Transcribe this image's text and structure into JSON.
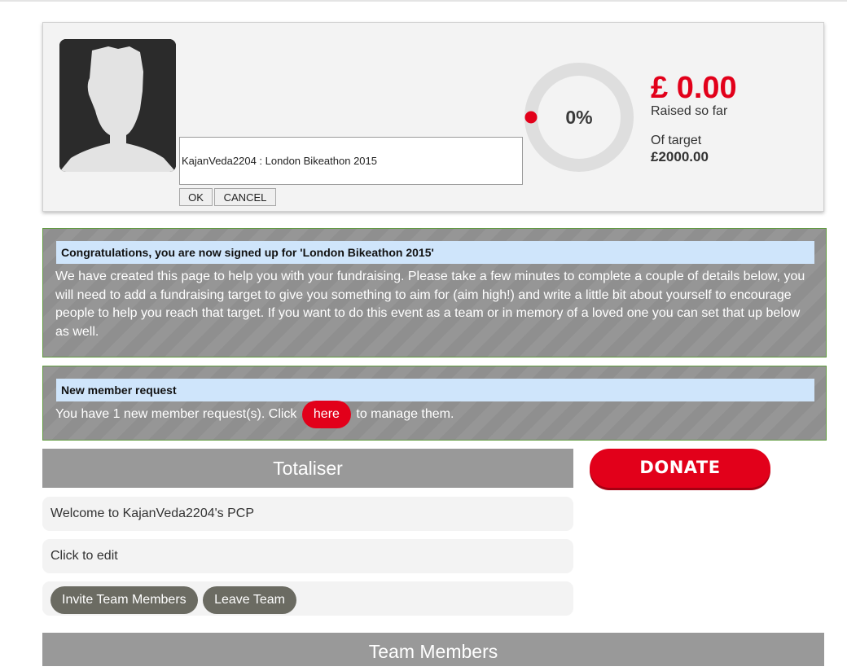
{
  "header": {
    "page_title_value": "KajanVeda2204 : London Bikeathon 2015",
    "ok_label": "OK",
    "cancel_label": "CANCEL",
    "progress_percent": "0%",
    "progress_fraction": 0,
    "raised_amount": "£ 0.00",
    "raised_label": "Raised so far",
    "target_label": "Of target",
    "target_value": "£2000.00"
  },
  "congrats": {
    "heading": "Congratulations, you are now signed up for 'London Bikeathon 2015'",
    "body": "We have created this page to help you with your fundraising. Please take a few minutes to complete a couple of details below, you will need to add a fundraising target to give you something to aim for (aim high!) and write a little bit about yourself to encourage people to help you reach that target. If you want to do this event as a team or in memory of a loved one you can set that up below as well."
  },
  "member_request": {
    "heading": "New member request",
    "text_before": "You have 1 new member request(s). Click",
    "link_label": "here",
    "text_after": "to manage them."
  },
  "totaliser": {
    "title": "Totaliser",
    "donate_label": "DONATE",
    "welcome_text": "Welcome to KajanVeda2204's PCP",
    "edit_text": "Click to edit",
    "invite_label": "Invite Team Members",
    "leave_label": "Leave Team"
  },
  "team_members": {
    "title": "Team Members"
  },
  "colors": {
    "brand_red": "#e2001a",
    "panel_grey": "#8f8f8f",
    "heading_blue": "#cfe5fb",
    "panel_border_green": "#5f9a3e"
  },
  "icons": {
    "avatar": "default-user-silhouette-icon"
  }
}
